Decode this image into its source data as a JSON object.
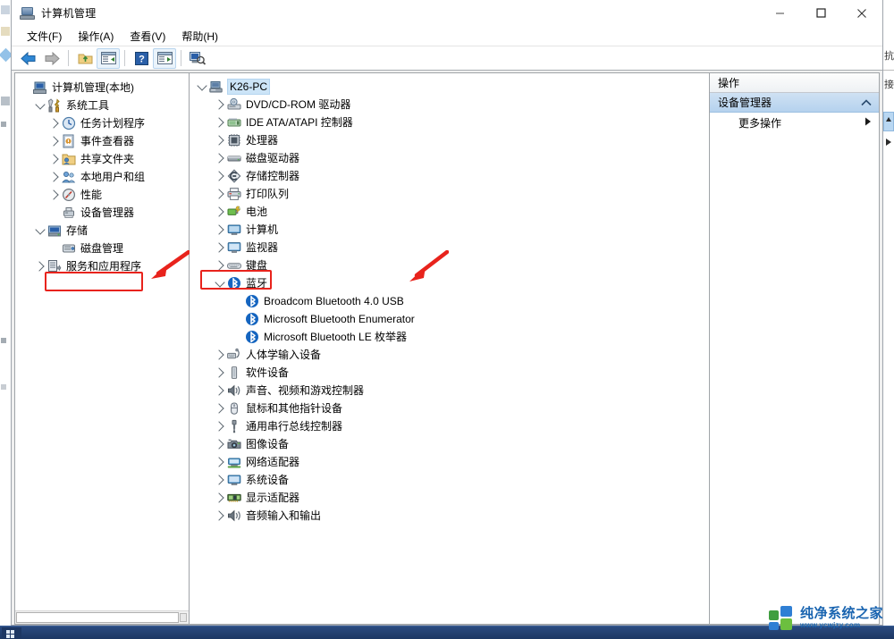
{
  "window": {
    "title": "计算机管理",
    "app_icon": "computer-management-icon",
    "controls": {
      "minimize": "minimize-icon",
      "maximize": "maximize-icon",
      "close": "close-icon"
    }
  },
  "menubar": {
    "items": [
      {
        "label": "文件(F)",
        "text": "文件",
        "accel": "F"
      },
      {
        "label": "操作(A)",
        "text": "操作",
        "accel": "A"
      },
      {
        "label": "查看(V)",
        "text": "查看",
        "accel": "V"
      },
      {
        "label": "帮助(H)",
        "text": "帮助",
        "accel": "H"
      }
    ]
  },
  "toolbar": {
    "buttons": [
      {
        "name": "back-arrow-icon",
        "enabled": true
      },
      {
        "name": "forward-arrow-icon",
        "enabled": false
      },
      {
        "name": "up-folder-icon",
        "enabled": true
      },
      {
        "name": "show-hide-console-tree-icon",
        "enabled": true
      },
      {
        "name": "help-icon",
        "enabled": true
      },
      {
        "name": "properties-icon",
        "enabled": true
      },
      {
        "name": "scan-hardware-changes-icon",
        "enabled": true
      }
    ]
  },
  "left_tree": {
    "root": {
      "label": "计算机管理(本地)",
      "icon": "computer-management-icon",
      "level": 0,
      "twisty": "none"
    },
    "items": [
      {
        "label": "系统工具",
        "icon": "system-tools-icon",
        "level": 1,
        "twisty": "down"
      },
      {
        "label": "任务计划程序",
        "icon": "task-scheduler-icon",
        "level": 2,
        "twisty": "right"
      },
      {
        "label": "事件查看器",
        "icon": "event-viewer-icon",
        "level": 2,
        "twisty": "right"
      },
      {
        "label": "共享文件夹",
        "icon": "shared-folders-icon",
        "level": 2,
        "twisty": "right"
      },
      {
        "label": "本地用户和组",
        "icon": "local-users-groups-icon",
        "level": 2,
        "twisty": "right"
      },
      {
        "label": "性能",
        "icon": "performance-icon",
        "level": 2,
        "twisty": "right"
      },
      {
        "label": "设备管理器",
        "icon": "device-manager-icon",
        "level": 2,
        "twisty": "none",
        "highlighted": true
      },
      {
        "label": "存储",
        "icon": "storage-icon",
        "level": 1,
        "twisty": "down"
      },
      {
        "label": "磁盘管理",
        "icon": "disk-management-icon",
        "level": 2,
        "twisty": "none"
      },
      {
        "label": "服务和应用程序",
        "icon": "services-applications-icon",
        "level": 1,
        "twisty": "right"
      }
    ]
  },
  "device_tree": {
    "root": {
      "label": "K26-PC",
      "icon": "computer-icon",
      "level": 0,
      "twisty": "down",
      "selected": true
    },
    "items": [
      {
        "label": "DVD/CD-ROM 驱动器",
        "icon": "dvd-drive-icon",
        "level": 1,
        "twisty": "right"
      },
      {
        "label": "IDE ATA/ATAPI 控制器",
        "icon": "ide-controller-icon",
        "level": 1,
        "twisty": "right"
      },
      {
        "label": "处理器",
        "icon": "processor-icon",
        "level": 1,
        "twisty": "right"
      },
      {
        "label": "磁盘驱动器",
        "icon": "disk-drive-icon",
        "level": 1,
        "twisty": "right"
      },
      {
        "label": "存储控制器",
        "icon": "storage-controller-icon",
        "level": 1,
        "twisty": "right"
      },
      {
        "label": "打印队列",
        "icon": "print-queue-icon",
        "level": 1,
        "twisty": "right"
      },
      {
        "label": "电池",
        "icon": "battery-icon",
        "level": 1,
        "twisty": "right"
      },
      {
        "label": "计算机",
        "icon": "computer-device-icon",
        "level": 1,
        "twisty": "right"
      },
      {
        "label": "监视器",
        "icon": "monitor-icon",
        "level": 1,
        "twisty": "right"
      },
      {
        "label": "键盘",
        "icon": "keyboard-icon",
        "level": 1,
        "twisty": "right"
      },
      {
        "label": "蓝牙",
        "icon": "bluetooth-icon",
        "level": 1,
        "twisty": "down",
        "highlighted": true
      },
      {
        "label": "Broadcom Bluetooth 4.0 USB",
        "icon": "bluetooth-icon",
        "level": 2,
        "twisty": "none"
      },
      {
        "label": "Microsoft Bluetooth Enumerator",
        "icon": "bluetooth-icon",
        "level": 2,
        "twisty": "none"
      },
      {
        "label": "Microsoft Bluetooth LE 枚举器",
        "icon": "bluetooth-icon",
        "level": 2,
        "twisty": "none"
      },
      {
        "label": "人体学输入设备",
        "icon": "hid-icon",
        "level": 1,
        "twisty": "right"
      },
      {
        "label": "软件设备",
        "icon": "software-device-icon",
        "level": 1,
        "twisty": "right"
      },
      {
        "label": "声音、视频和游戏控制器",
        "icon": "sound-video-game-icon",
        "level": 1,
        "twisty": "right"
      },
      {
        "label": "鼠标和其他指针设备",
        "icon": "mouse-icon",
        "level": 1,
        "twisty": "right"
      },
      {
        "label": "通用串行总线控制器",
        "icon": "usb-controller-icon",
        "level": 1,
        "twisty": "right"
      },
      {
        "label": "图像设备",
        "icon": "imaging-device-icon",
        "level": 1,
        "twisty": "right"
      },
      {
        "label": "网络适配器",
        "icon": "network-adapter-icon",
        "level": 1,
        "twisty": "right"
      },
      {
        "label": "系统设备",
        "icon": "system-device-icon",
        "level": 1,
        "twisty": "right"
      },
      {
        "label": "显示适配器",
        "icon": "display-adapter-icon",
        "level": 1,
        "twisty": "right"
      },
      {
        "label": "音频输入和输出",
        "icon": "audio-io-icon",
        "level": 1,
        "twisty": "right"
      }
    ]
  },
  "actions_pane": {
    "title": "操作",
    "group_header": "设备管理器",
    "group_caret": "collapse-caret-icon",
    "rows": [
      {
        "label": "更多操作",
        "arrow": "submenu-arrow-icon"
      }
    ]
  },
  "annotations": {
    "boxes": [
      {
        "name": "device-manager-highlight-box",
        "color": "#e8231c"
      },
      {
        "name": "bluetooth-highlight-box",
        "color": "#e8231c"
      }
    ],
    "arrows": [
      {
        "name": "device-manager-pointer-arrow",
        "color": "#e8231c"
      },
      {
        "name": "bluetooth-pointer-arrow",
        "color": "#e8231c"
      }
    ]
  },
  "watermark": {
    "brand_cn": "纯净系统之家",
    "url": "www.ycwjzy.com",
    "brand_color": "#1964b0"
  },
  "edge_window": {
    "right_fragments": [
      "抗",
      "接"
    ]
  }
}
